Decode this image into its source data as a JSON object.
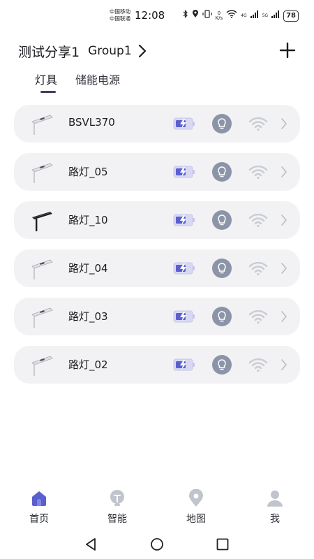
{
  "status_bar": {
    "carrier_1": "中国移动",
    "carrier_2": "中国联通",
    "time": "12:08",
    "net_speed_value": "0",
    "net_speed_unit": "K/s",
    "signal_1": "4G",
    "signal_2": "5G",
    "battery": "78"
  },
  "header": {
    "title": "测试分享1",
    "group": "Group1"
  },
  "tabs": [
    {
      "label": "灯具",
      "active": true
    },
    {
      "label": "储能电源",
      "active": false
    }
  ],
  "devices": [
    {
      "name": "BSVL370",
      "icon": "street-lamp-icon"
    },
    {
      "name": "路灯_05",
      "icon": "street-lamp-icon"
    },
    {
      "name": "路灯_10",
      "icon": "street-lamp-black-icon"
    },
    {
      "name": "路灯_04",
      "icon": "street-lamp-icon"
    },
    {
      "name": "路灯_03",
      "icon": "street-lamp-icon"
    },
    {
      "name": "路灯_02",
      "icon": "street-lamp-icon"
    }
  ],
  "bottom_nav": [
    {
      "label": "首页",
      "icon": "home-icon",
      "active": true
    },
    {
      "label": "智能",
      "icon": "smart-icon",
      "active": false
    },
    {
      "label": "地图",
      "icon": "map-pin-icon",
      "active": false
    },
    {
      "label": "我",
      "icon": "user-icon",
      "active": false
    }
  ],
  "colors": {
    "card_bg": "#f2f2f4",
    "accent": "#5a5fd0",
    "bulb_bg": "#8c94a8",
    "wifi": "#c9ccd3",
    "nav_inactive": "#c0c4cc"
  }
}
